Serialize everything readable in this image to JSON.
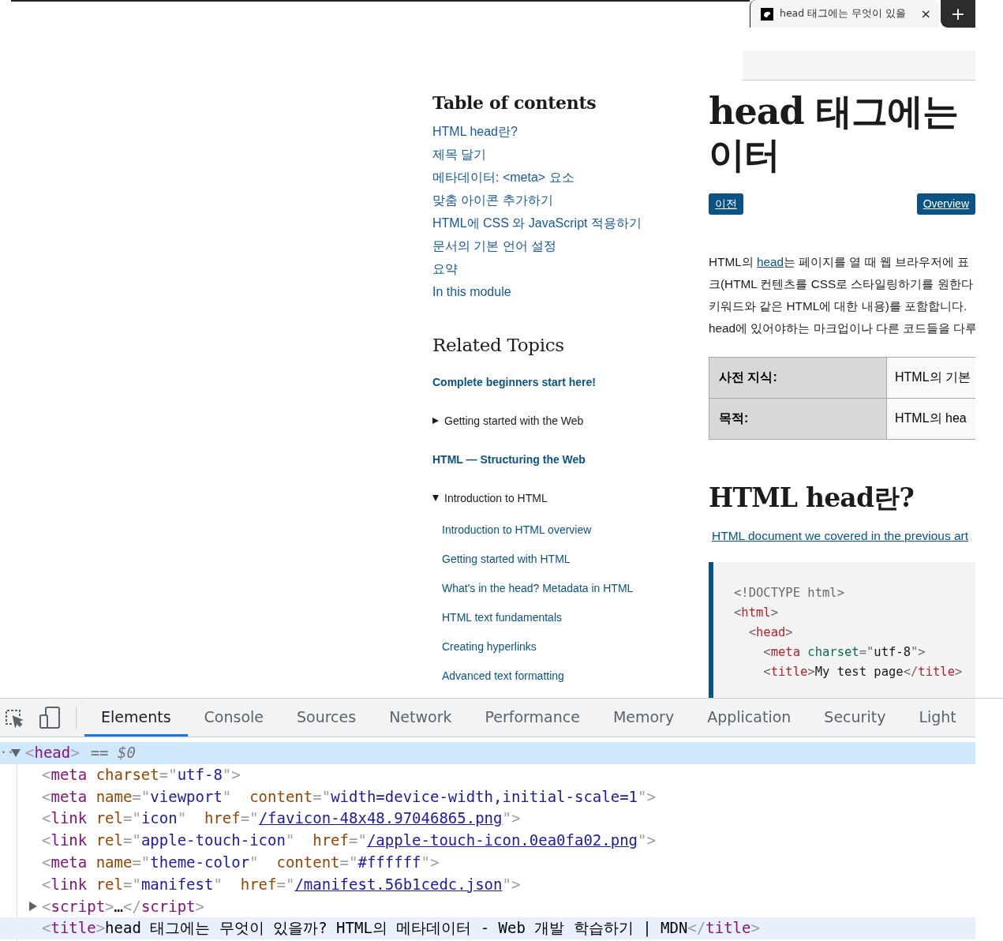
{
  "browser_tab": {
    "title": "head 태그에는 무엇이 있을",
    "close": "×",
    "new_tab": "+"
  },
  "toc": {
    "title": "Table of contents",
    "items": [
      "HTML head란?",
      "제목 달기",
      "메타데이터: <meta> 요소",
      "맞춤 아이콘 추가하기",
      "HTML에 CSS 와 JavaScript 적용하기",
      "문서의 기본 언어 설정",
      "요약",
      "In this module"
    ]
  },
  "related": {
    "title": "Related Topics",
    "items": [
      {
        "kind": "section",
        "label": "Complete beginners start here!"
      },
      {
        "kind": "group",
        "label": "Getting started with the Web",
        "expanded": false
      },
      {
        "kind": "section",
        "label": "HTML — Structuring the Web"
      },
      {
        "kind": "group",
        "label": "Introduction to HTML",
        "expanded": true,
        "children": [
          "Introduction to HTML overview",
          "Getting started with HTML",
          "What's in the head? Metadata in HTML",
          "HTML text fundamentals",
          "Creating hyperlinks",
          "Advanced text formatting"
        ]
      }
    ]
  },
  "article": {
    "heading_lines": [
      "head 태그에는",
      "이터"
    ],
    "nav_buttons": [
      "이전",
      "Overview"
    ],
    "intro_lines": [
      [
        {
          "kind": "text",
          "text": "HTML의 "
        },
        {
          "kind": "link",
          "text": "head"
        },
        {
          "kind": "text",
          "text": "는 페이지를 열 때 웹 브라우저에 표"
        }
      ],
      [
        {
          "kind": "text",
          "text": "크(HTML 컨텐츠를 CSS로 스타일링하기를 원한다"
        }
      ],
      [
        {
          "kind": "text",
          "text": "키워드와 같은 HTML에 대한 내용)를 포함합니다."
        }
      ],
      [
        {
          "kind": "text",
          "text": "head에 있어야하는 마크업이나 다른 코드들을 다루"
        }
      ]
    ],
    "table": {
      "rows": [
        {
          "header": "사전 지식:",
          "value": "HTML의 기본"
        },
        {
          "header": "목적:",
          "value": "HTML의 hea"
        }
      ]
    },
    "section_heading": "HTML head란?",
    "link": "HTML document we covered in the previous art",
    "code": [
      [
        {
          "kind": "punct",
          "text": "<!DOCTYPE html>"
        }
      ],
      [
        {
          "kind": "punct",
          "text": "<"
        },
        {
          "kind": "tag",
          "text": "html"
        },
        {
          "kind": "punct",
          "text": ">"
        }
      ],
      [
        {
          "kind": "punct",
          "text": "  <"
        },
        {
          "kind": "tag",
          "text": "head"
        },
        {
          "kind": "punct",
          "text": ">"
        }
      ],
      [
        {
          "kind": "punct",
          "text": "    <"
        },
        {
          "kind": "tag",
          "text": "meta"
        },
        {
          "kind": "attr",
          "text": " charset"
        },
        {
          "kind": "punct",
          "text": "=\""
        },
        {
          "kind": "value",
          "text": "utf-8"
        },
        {
          "kind": "punct",
          "text": "\">"
        }
      ],
      [
        {
          "kind": "punct",
          "text": "    <"
        },
        {
          "kind": "tag",
          "text": "title"
        },
        {
          "kind": "punct",
          "text": ">"
        },
        {
          "kind": "text",
          "text": "My test page"
        },
        {
          "kind": "punct",
          "text": "</"
        },
        {
          "kind": "tag",
          "text": "title"
        },
        {
          "kind": "punct",
          "text": ">"
        }
      ]
    ]
  },
  "devtools": {
    "tabs": [
      {
        "label": "Elements",
        "selected": true
      },
      {
        "label": "Console",
        "selected": false
      },
      {
        "label": "Sources",
        "selected": false
      },
      {
        "label": "Network",
        "selected": false
      },
      {
        "label": "Performance",
        "selected": false
      },
      {
        "label": "Memory",
        "selected": false
      },
      {
        "label": "Application",
        "selected": false
      },
      {
        "label": "Security",
        "selected": false
      },
      {
        "label": "Light",
        "selected": false
      }
    ],
    "dom": {
      "tokens": [
        {
          "kind": "punct",
          "text": "<"
        },
        {
          "kind": "tag",
          "text": "head"
        },
        {
          "kind": "punct",
          "text": ">"
        }
      ],
      "marker": "··",
      "suffix": "== $0",
      "expanded": true,
      "selected": true,
      "children": [
        {
          "selected": false,
          "hovered": false,
          "tokens": [
            {
              "kind": "punct",
              "text": "<"
            },
            {
              "kind": "tag",
              "text": "meta"
            },
            {
              "kind": "attr",
              "text": " charset"
            },
            {
              "kind": "punct",
              "text": "=\""
            },
            {
              "kind": "value",
              "text": "utf-8"
            },
            {
              "kind": "punct",
              "text": "\">"
            }
          ]
        },
        {
          "selected": false,
          "hovered": false,
          "tokens": [
            {
              "kind": "punct",
              "text": "<"
            },
            {
              "kind": "tag",
              "text": "meta"
            },
            {
              "kind": "attr",
              "text": " name"
            },
            {
              "kind": "punct",
              "text": "=\""
            },
            {
              "kind": "value",
              "text": "viewport"
            },
            {
              "kind": "punct",
              "text": "\""
            },
            {
              "kind": "attr",
              "text": "  content"
            },
            {
              "kind": "punct",
              "text": "=\""
            },
            {
              "kind": "value",
              "text": "width=device-width,initial-scale=1"
            },
            {
              "kind": "punct",
              "text": "\">"
            }
          ]
        },
        {
          "selected": false,
          "hovered": false,
          "tokens": [
            {
              "kind": "punct",
              "text": "<"
            },
            {
              "kind": "tag",
              "text": "link"
            },
            {
              "kind": "attr",
              "text": " rel"
            },
            {
              "kind": "punct",
              "text": "=\""
            },
            {
              "kind": "value",
              "text": "icon"
            },
            {
              "kind": "punct",
              "text": "\""
            },
            {
              "kind": "attr",
              "text": "  href"
            },
            {
              "kind": "punct",
              "text": "=\""
            },
            {
              "kind": "link",
              "text": "/favicon-48x48.97046865.png"
            },
            {
              "kind": "punct",
              "text": "\">"
            }
          ]
        },
        {
          "selected": false,
          "hovered": false,
          "tokens": [
            {
              "kind": "punct",
              "text": "<"
            },
            {
              "kind": "tag",
              "text": "link"
            },
            {
              "kind": "attr",
              "text": " rel"
            },
            {
              "kind": "punct",
              "text": "=\""
            },
            {
              "kind": "value",
              "text": "apple-touch-icon"
            },
            {
              "kind": "punct",
              "text": "\""
            },
            {
              "kind": "attr",
              "text": "  href"
            },
            {
              "kind": "punct",
              "text": "=\""
            },
            {
              "kind": "link",
              "text": "/apple-touch-icon.0ea0fa02.png"
            },
            {
              "kind": "punct",
              "text": "\">"
            }
          ]
        },
        {
          "selected": false,
          "hovered": false,
          "tokens": [
            {
              "kind": "punct",
              "text": "<"
            },
            {
              "kind": "tag",
              "text": "meta"
            },
            {
              "kind": "attr",
              "text": " name"
            },
            {
              "kind": "punct",
              "text": "=\""
            },
            {
              "kind": "value",
              "text": "theme-color"
            },
            {
              "kind": "punct",
              "text": "\""
            },
            {
              "kind": "attr",
              "text": "  content"
            },
            {
              "kind": "punct",
              "text": "=\""
            },
            {
              "kind": "value",
              "text": "#ffffff"
            },
            {
              "kind": "punct",
              "text": "\">"
            }
          ]
        },
        {
          "selected": false,
          "hovered": false,
          "tokens": [
            {
              "kind": "punct",
              "text": "<"
            },
            {
              "kind": "tag",
              "text": "link"
            },
            {
              "kind": "attr",
              "text": " rel"
            },
            {
              "kind": "punct",
              "text": "=\""
            },
            {
              "kind": "value",
              "text": "manifest"
            },
            {
              "kind": "punct",
              "text": "\""
            },
            {
              "kind": "attr",
              "text": "  href"
            },
            {
              "kind": "punct",
              "text": "=\""
            },
            {
              "kind": "link",
              "text": "/manifest.56b1cedc.json"
            },
            {
              "kind": "punct",
              "text": "\">"
            }
          ]
        },
        {
          "selected": false,
          "hovered": false,
          "expanded": false,
          "tokens": [
            {
              "kind": "punct",
              "text": "<"
            },
            {
              "kind": "tag",
              "text": "script"
            },
            {
              "kind": "punct",
              "text": ">"
            },
            {
              "kind": "text",
              "text": "…"
            },
            {
              "kind": "punct",
              "text": "</"
            },
            {
              "kind": "tag",
              "text": "script"
            },
            {
              "kind": "punct",
              "text": ">"
            }
          ]
        },
        {
          "selected": false,
          "hovered": true,
          "tokens": [
            {
              "kind": "punct",
              "text": "<"
            },
            {
              "kind": "tag",
              "text": "title"
            },
            {
              "kind": "punct",
              "text": ">"
            },
            {
              "kind": "text",
              "text": "head 태그에는 무엇이 있을까? HTML의 메타데이터 - Web 개발 학습하기 | MDN"
            },
            {
              "kind": "punct",
              "text": "</"
            },
            {
              "kind": "tag",
              "text": "title"
            },
            {
              "kind": "punct",
              "text": ">"
            }
          ]
        }
      ]
    }
  }
}
